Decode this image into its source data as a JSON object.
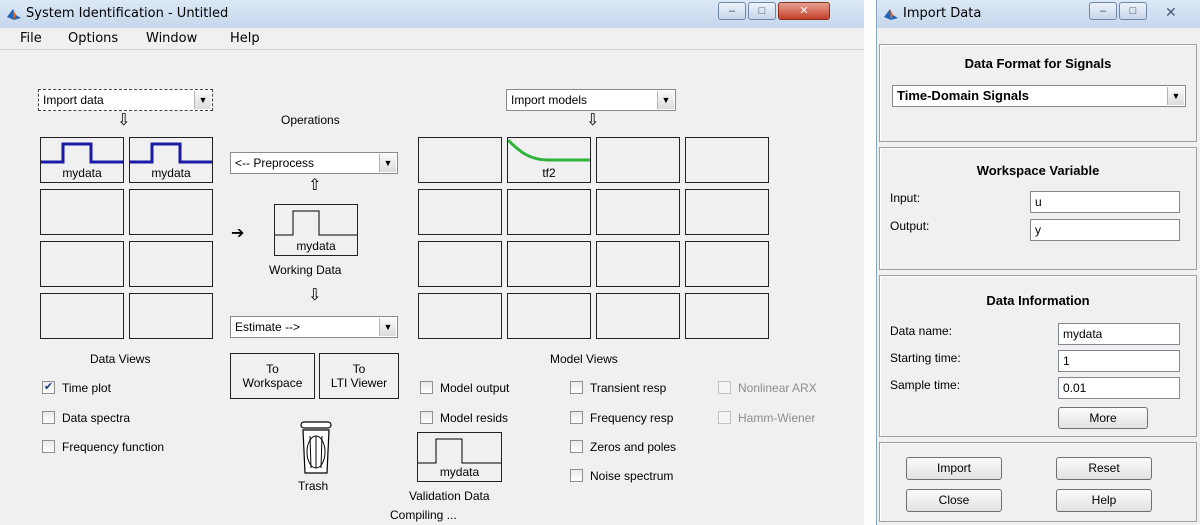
{
  "sysid": {
    "title": "System Identification - Untitled",
    "menu": [
      "File",
      "Options",
      "Window",
      "Help"
    ],
    "import_data_popup": "Import data",
    "import_models_popup": "Import models",
    "operations_label": "Operations",
    "preprocess_popup": "<-- Preprocess",
    "estimate_popup": "Estimate -->",
    "working_data_label": "Working Data",
    "working_data_name": "mydata",
    "data_cells": [
      "mydata",
      "mydata"
    ],
    "model_cells": [
      "tf2"
    ],
    "data_views_label": "Data Views",
    "model_views_label": "Model Views",
    "to_workspace": [
      "To",
      "Workspace"
    ],
    "to_lti_viewer": [
      "To",
      "LTI Viewer"
    ],
    "data_view_checks": [
      {
        "label": "Time plot",
        "checked": true
      },
      {
        "label": "Data spectra",
        "checked": false
      },
      {
        "label": "Frequency function",
        "checked": false
      }
    ],
    "model_view_checks": [
      {
        "label": "Model output",
        "checked": false
      },
      {
        "label": "Model resids",
        "checked": false
      },
      {
        "label": "Transient resp",
        "checked": false
      },
      {
        "label": "Frequency resp",
        "checked": false
      },
      {
        "label": "Zeros and poles",
        "checked": false
      },
      {
        "label": "Noise spectrum",
        "checked": false
      },
      {
        "label": "Nonlinear ARX",
        "checked": false,
        "disabled": true
      },
      {
        "label": "Hamm-Wiener",
        "checked": false,
        "disabled": true
      }
    ],
    "trash_label": "Trash",
    "validation_data_name": "mydata",
    "validation_data_label": "Validation Data",
    "status": "Compiling ...",
    "colors": {
      "data_signal": "#1a1aa8",
      "model_curve": "#2fb33a"
    }
  },
  "import_dialog": {
    "title": "Import Data",
    "format_title": "Data Format for Signals",
    "format_value": "Time-Domain Signals",
    "workspace_title": "Workspace Variable",
    "input_label": "Input:",
    "input_value": "u",
    "output_label": "Output:",
    "output_value": "y",
    "info_title": "Data Information",
    "data_name_label": "Data name:",
    "data_name_value": "mydata",
    "start_label": "Starting time:",
    "start_value": "1",
    "sample_label": "Sample time:",
    "sample_value": "0.01",
    "more_button": "More",
    "import_button": "Import",
    "reset_button": "Reset",
    "close_button": "Close",
    "help_button": "Help"
  }
}
